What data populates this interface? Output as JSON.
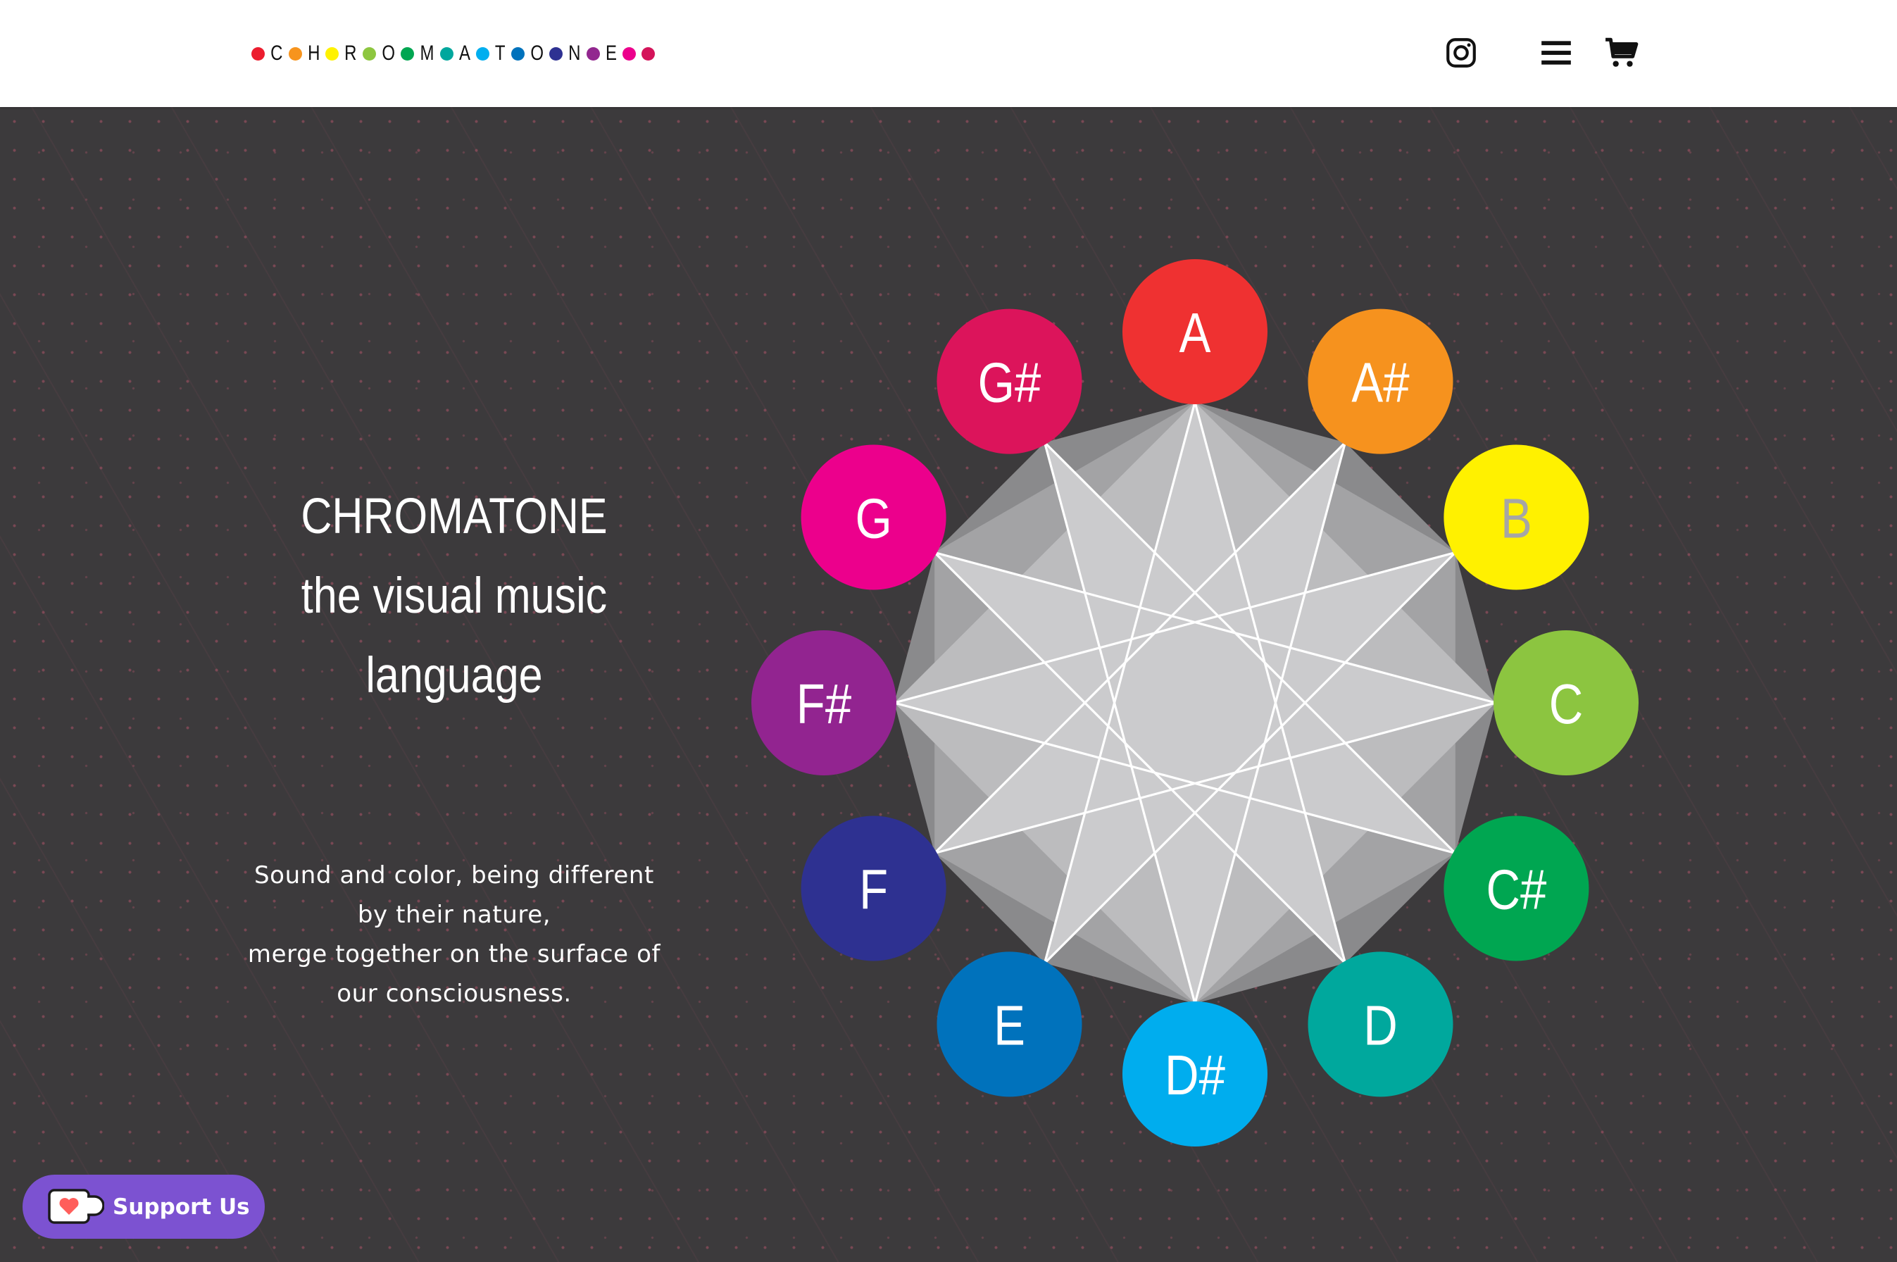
{
  "header": {
    "logo": {
      "items": [
        {
          "dot": "#ec1d2e"
        },
        {
          "char": "C",
          "dot": "#f7941d"
        },
        {
          "char": "H",
          "dot": "#fff200"
        },
        {
          "char": "R",
          "dot": "#8dc63f"
        },
        {
          "char": "O",
          "dot": "#00a651"
        },
        {
          "char": "M",
          "dot": "#00a79d"
        },
        {
          "char": "A",
          "dot": "#00aeef"
        },
        {
          "char": "T",
          "dot": "#0072bc"
        },
        {
          "char": "O",
          "dot": "#2e3192"
        },
        {
          "char": "N",
          "dot": "#92278f"
        },
        {
          "char": "E",
          "dot": "#ec008c"
        },
        {
          "dot": "#d4145a"
        }
      ]
    },
    "icons": [
      "instagram-icon",
      "menu-icon",
      "cart-icon"
    ]
  },
  "hero": {
    "title_lines": [
      "CHROMATONE",
      "the visual music",
      "language"
    ],
    "description_lines": [
      "Sound and color, being different",
      "by their nature,",
      "merge together on the surface of",
      "our consciousness."
    ]
  },
  "wheel": {
    "notes": [
      {
        "label": "A",
        "color": "#ef3131",
        "text_color": "#ffffff"
      },
      {
        "label": "A#",
        "color": "#f6921e",
        "text_color": "#ffffff"
      },
      {
        "label": "B",
        "color": "#fff100",
        "text_color": "#a6a6a6"
      },
      {
        "label": "C",
        "color": "#8cc540",
        "text_color": "#ffffff"
      },
      {
        "label": "C#",
        "color": "#00a651",
        "text_color": "#ffffff"
      },
      {
        "label": "D",
        "color": "#00a89d",
        "text_color": "#ffffff"
      },
      {
        "label": "D#",
        "color": "#00adee",
        "text_color": "#ffffff"
      },
      {
        "label": "E",
        "color": "#0072bc",
        "text_color": "#ffffff"
      },
      {
        "label": "F",
        "color": "#2e3191",
        "text_color": "#ffffff"
      },
      {
        "label": "F#",
        "color": "#922490",
        "text_color": "#ffffff"
      },
      {
        "label": "G",
        "color": "#ec008c",
        "text_color": "#ffffff"
      },
      {
        "label": "G#",
        "color": "#dc145b",
        "text_color": "#ffffff"
      }
    ]
  },
  "support": {
    "label": "Support Us",
    "icon": "kofi-cup-icon"
  }
}
